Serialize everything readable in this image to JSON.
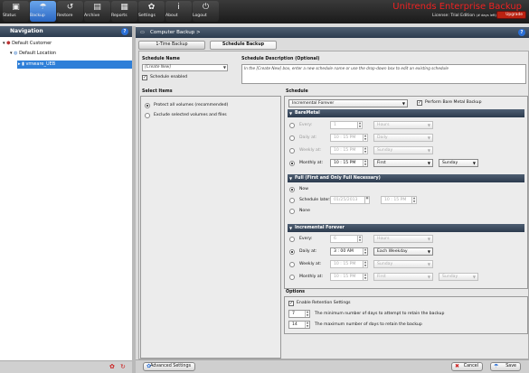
{
  "toolbar": {
    "buttons": [
      {
        "label": "Status",
        "icon": "▣"
      },
      {
        "label": "Backup",
        "icon": "☂"
      },
      {
        "label": "Restore",
        "icon": "↺"
      },
      {
        "label": "Archive",
        "icon": "▤"
      },
      {
        "label": "Reports",
        "icon": "▦"
      },
      {
        "label": "Settings",
        "icon": "✿"
      },
      {
        "label": "About",
        "icon": "i"
      },
      {
        "label": "Logout",
        "icon": "⏻"
      }
    ],
    "brand": "Unitrends Enterprise Backup",
    "license": "License: Trial Edition",
    "days_left": "(# days left)",
    "upgrade": "Upgrade"
  },
  "nav": {
    "title": "Navigation",
    "help": "?",
    "tree": [
      {
        "label": "Default Customer"
      },
      {
        "label": "Default Location"
      },
      {
        "label": "vmware_UEB"
      }
    ]
  },
  "breadcrumb": {
    "text": "Computer Backup >"
  },
  "tabs": {
    "one_time": "1-Time Backup",
    "schedule": "Schedule Backup"
  },
  "form": {
    "schedule_name_label": "Schedule Name",
    "schedule_name_placeholder": "[Create New]",
    "schedule_enabled": "Schedule enabled",
    "desc_label": "Schedule Description (Optional)",
    "desc_placeholder": "In the [Create New] box, enter a new schedule name or use the drop-down box to edit an existing schedule",
    "select_items_label": "Select Items",
    "protect_all": "Protect all volumes (recommended)",
    "exclude_selected": "Exclude selected volumes and files",
    "schedule_label": "Schedule",
    "schedule_type": "Incremental Forever",
    "perform_bm": "Perform Bare Metal Backup"
  },
  "baremetal": {
    "title": "BareMetal",
    "every_label": "Every:",
    "every_value": "1",
    "every_unit": "Hours",
    "daily_label": "Daily at:",
    "daily_time": "10 : 15 PM",
    "daily_freq": "Daily",
    "weekly_label": "Weekly at:",
    "weekly_time": "10 : 15 PM",
    "weekly_day": "Sunday",
    "monthly_label": "Monthly at:",
    "monthly_time": "10 : 15 PM",
    "monthly_which": "First",
    "monthly_day": "Sunday"
  },
  "full": {
    "title": "Full (First and Only Full Necessary)",
    "now": "Now",
    "later_label": "Schedule later:",
    "later_date": "01/25/2013",
    "later_time": "10 : 15 PM",
    "none": "None"
  },
  "incremental": {
    "title": "Incremental Forever",
    "every_label": "Every:",
    "every_value": "6",
    "every_unit": "Hours",
    "daily_label": "Daily at:",
    "daily_time": "3 : 00 AM",
    "daily_freq": "Each Weekday",
    "weekly_label": "Weekly at:",
    "weekly_time": "10 : 15 PM",
    "weekly_day": "Sunday",
    "monthly_label": "Monthly at:",
    "monthly_time": "10 : 15 PM",
    "monthly_which": "First",
    "monthly_day": "Sunday"
  },
  "options": {
    "label": "Options",
    "enable_retention": "Enable Retention Settings",
    "min_value": "7",
    "min_label": "The minimum number of days to attempt to retain the backup",
    "max_value": "14",
    "max_label": "The maximum number of days to retain the backup"
  },
  "bottom": {
    "advanced": "Advanced Settings",
    "cancel": "Cancel",
    "save": "Save"
  },
  "colors": {
    "brand": "#e22222",
    "header": "#2c3b4e",
    "selected": "#2e7fd8"
  }
}
